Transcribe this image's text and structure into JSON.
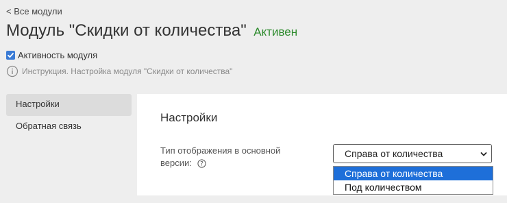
{
  "header": {
    "back_link": "< Все модули",
    "title": "Модуль \"Скидки от количества\"",
    "status": "Активен"
  },
  "module": {
    "active_label": "Активность модуля",
    "active_checked": true,
    "instruction_text": "Инструкция. Настройка модуля \"Скидки от количества\""
  },
  "sidebar": {
    "items": [
      {
        "label": "Настройки",
        "active": true
      },
      {
        "label": "Обратная связь",
        "active": false
      }
    ]
  },
  "settings": {
    "title": "Настройки",
    "field_label": "Тип отображения в основной версии:",
    "select_value": "Справа от количества",
    "options": [
      {
        "label": "Справа от количества",
        "selected": true
      },
      {
        "label": "Под количеством",
        "selected": false
      }
    ]
  },
  "colors": {
    "status_active": "#2e8b2e",
    "checkbox": "#3a7bd5",
    "option_highlight": "#1e6fd9",
    "page_background": "#eeeeee"
  },
  "icons": {
    "info": "info-circle-icon",
    "help": "question-circle-icon",
    "select_arrow": "chevron-down-icon",
    "checkbox": "checkmark-icon"
  }
}
